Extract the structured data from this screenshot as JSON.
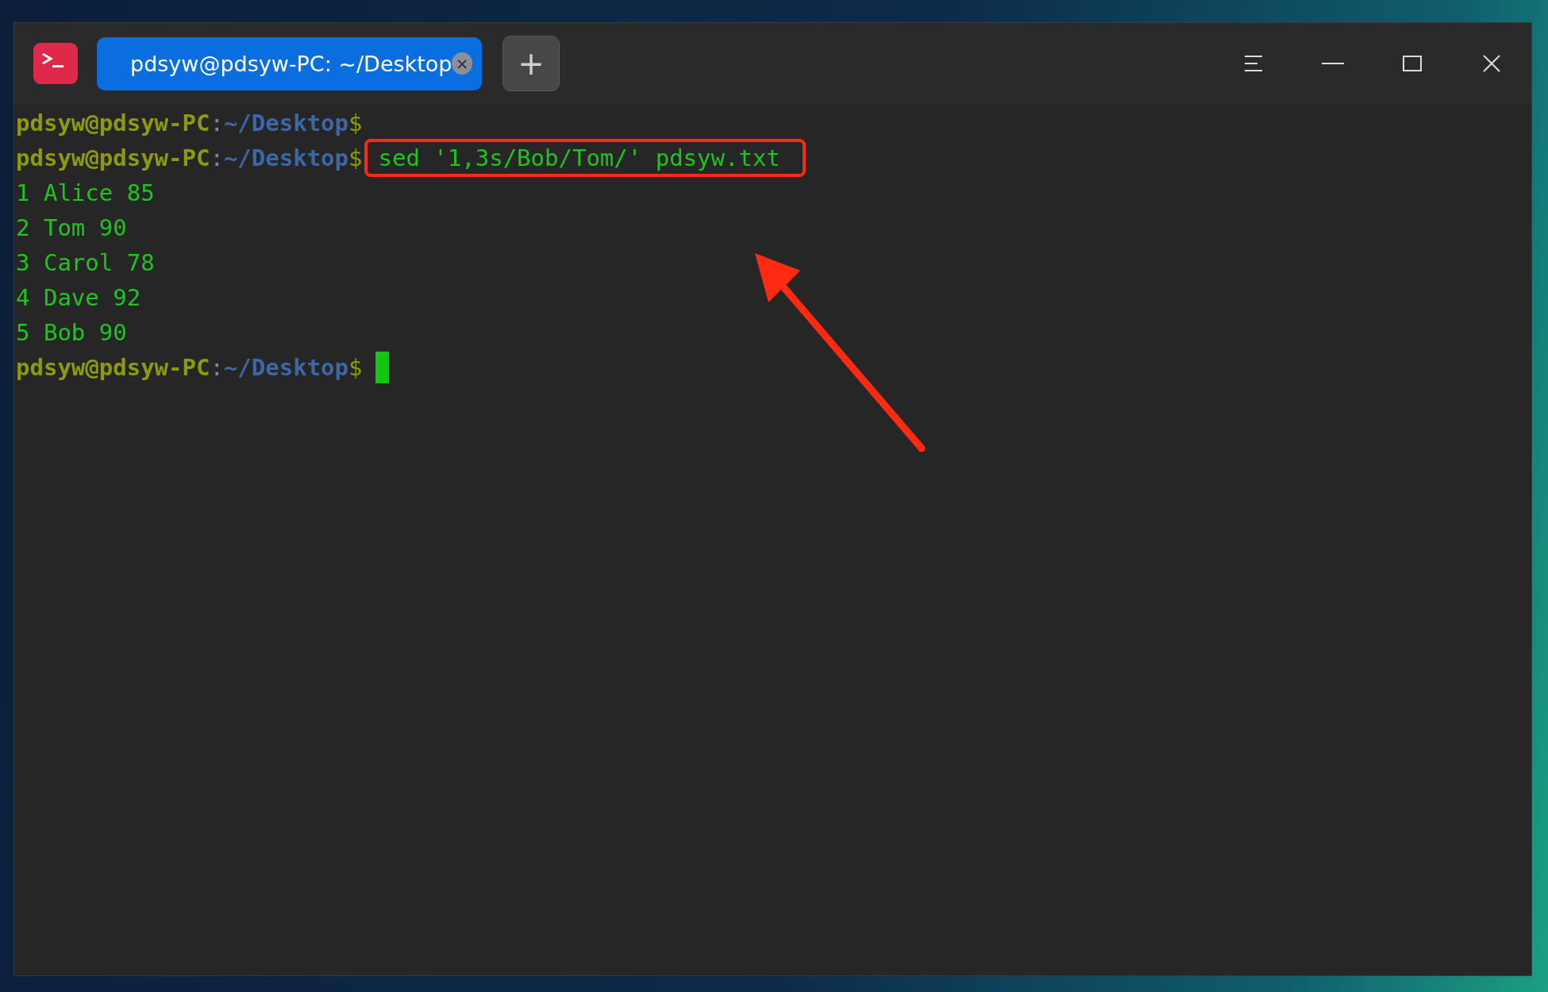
{
  "window": {
    "tab": {
      "title": "pdsyw@pdsyw-PC: ~/Desktop",
      "selected": true,
      "close": "×"
    },
    "new_tab": "+"
  },
  "terminal": {
    "lines": [
      {
        "kind": "prompt",
        "user": "pdsyw@pdsyw-PC",
        "sep": ":",
        "path": "~/Desktop",
        "sign": "$"
      },
      {
        "kind": "prompt",
        "user": "pdsyw@pdsyw-PC",
        "sep": ":",
        "path": "~/Desktop",
        "sign": "$",
        "command": "sed '1,3s/Bob/Tom/' pdsyw.txt",
        "highlighted": true
      },
      {
        "kind": "output",
        "text": "1 Alice 85"
      },
      {
        "kind": "output",
        "text": "2 Tom 90"
      },
      {
        "kind": "output",
        "text": "3 Carol 78"
      },
      {
        "kind": "output",
        "text": "4 Dave 92"
      },
      {
        "kind": "output",
        "text": "5 Bob 90"
      },
      {
        "kind": "prompt",
        "user": "pdsyw@pdsyw-PC",
        "sep": ":",
        "path": "~/Desktop",
        "sign": "$",
        "cursor": true
      }
    ]
  }
}
